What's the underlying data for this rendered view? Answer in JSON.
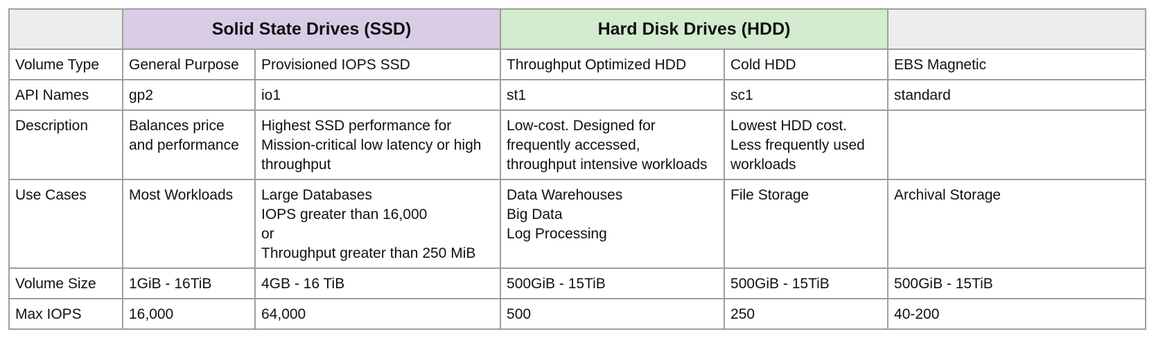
{
  "header": {
    "corner": "",
    "ssd_group": "Solid State Drives (SSD)",
    "hdd_group": "Hard Disk Drives (HDD)",
    "extra": ""
  },
  "rows": {
    "volume_type": {
      "label": "Volume Type",
      "cells": [
        "General Purpose",
        "Provisioned IOPS SSD",
        "Throughput Optimized HDD",
        "Cold HDD",
        "EBS Magnetic"
      ]
    },
    "api_names": {
      "label": "API Names",
      "cells": [
        "gp2",
        "io1",
        "st1",
        "sc1",
        "standard"
      ]
    },
    "description": {
      "label": "Description",
      "cells": [
        [
          "Balances price",
          "and performance"
        ],
        [
          "Highest SSD performance for",
          "Mission-critical low latency or high",
          "throughput"
        ],
        [
          "Low-cost. Designed for",
          "frequently accessed,",
          "throughput intensive workloads"
        ],
        [
          "Lowest HDD cost.",
          "Less frequently used",
          "workloads"
        ],
        []
      ]
    },
    "use_cases": {
      "label": "Use Cases",
      "cells": [
        [
          "Most Workloads"
        ],
        [
          "Large Databases",
          "IOPS greater than 16,000",
          "or",
          "Throughput greater than 250 MiB"
        ],
        [
          "Data Warehouses",
          "Big Data",
          "Log Processing"
        ],
        [
          "File Storage"
        ],
        [
          "Archival Storage"
        ]
      ]
    },
    "volume_size": {
      "label": "Volume Size",
      "cells": [
        "1GiB - 16TiB",
        "4GB - 16 TiB",
        "500GiB - 15TiB",
        "500GiB - 15TiB",
        "500GiB - 15TiB"
      ]
    },
    "max_iops": {
      "label": "Max IOPS",
      "cells": [
        "16,000",
        "64,000",
        "500",
        "250",
        "40-200"
      ]
    }
  }
}
